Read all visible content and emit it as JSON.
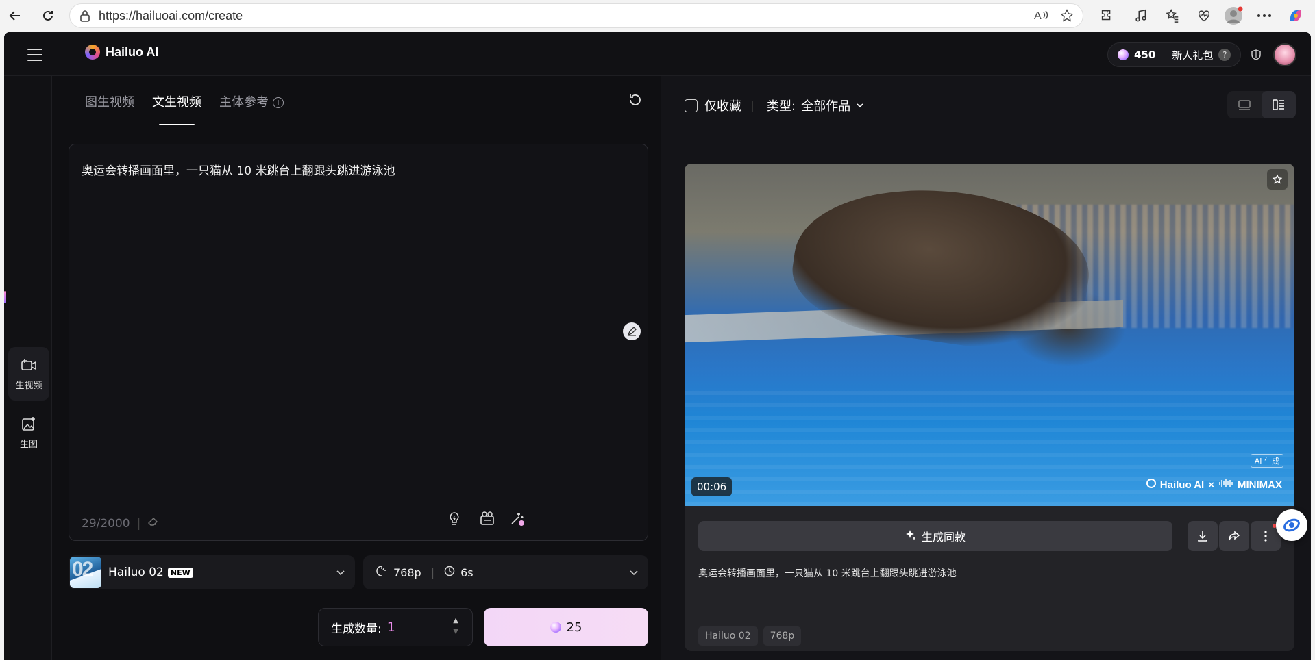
{
  "browser": {
    "url": "https://hailuoai.com/create"
  },
  "app": {
    "brand": "Hailuo AI",
    "credits": "450",
    "gift_label": "新人礼包",
    "help": "?"
  },
  "rail": {
    "items": [
      {
        "label": "生视频",
        "icon": "video-plus-icon",
        "active": true
      },
      {
        "label": "生图",
        "icon": "image-plus-icon",
        "active": false
      }
    ]
  },
  "create": {
    "tabs": [
      {
        "label": "图生视频",
        "active": false
      },
      {
        "label": "文生视频",
        "active": true
      },
      {
        "label": "主体参考",
        "active": false
      }
    ],
    "prompt_text": "奥运会转播画面里，一只猫从 10 米跳台上翻跟头跳进游泳池",
    "counter": "29/2000",
    "model": {
      "name": "Hailuo 02",
      "badge": "NEW"
    },
    "resolution": "768p",
    "duration": "6s",
    "quantity_label": "生成数量:",
    "quantity": "1",
    "cost": "25"
  },
  "gallery": {
    "fav_only": "仅收藏",
    "type_label": "类型:",
    "type_value": "全部作品",
    "video": {
      "time": "00:06",
      "ai_tag": "AI 生成",
      "watermark_brand": "Hailuo AI",
      "watermark_x": "×",
      "watermark_partner": "MINIMAX"
    },
    "generate_same": "生成同款",
    "prompt_text": "奥运会转播画面里，一只猫从 10 米跳台上翻跟头跳进游泳池",
    "chips": [
      "Hailuo 02",
      "768p"
    ]
  },
  "colors": {
    "accent_gradient_start": "#f3d7f7",
    "qty_accent": "#e88ae8",
    "panel_bg": "#0f0f12"
  }
}
